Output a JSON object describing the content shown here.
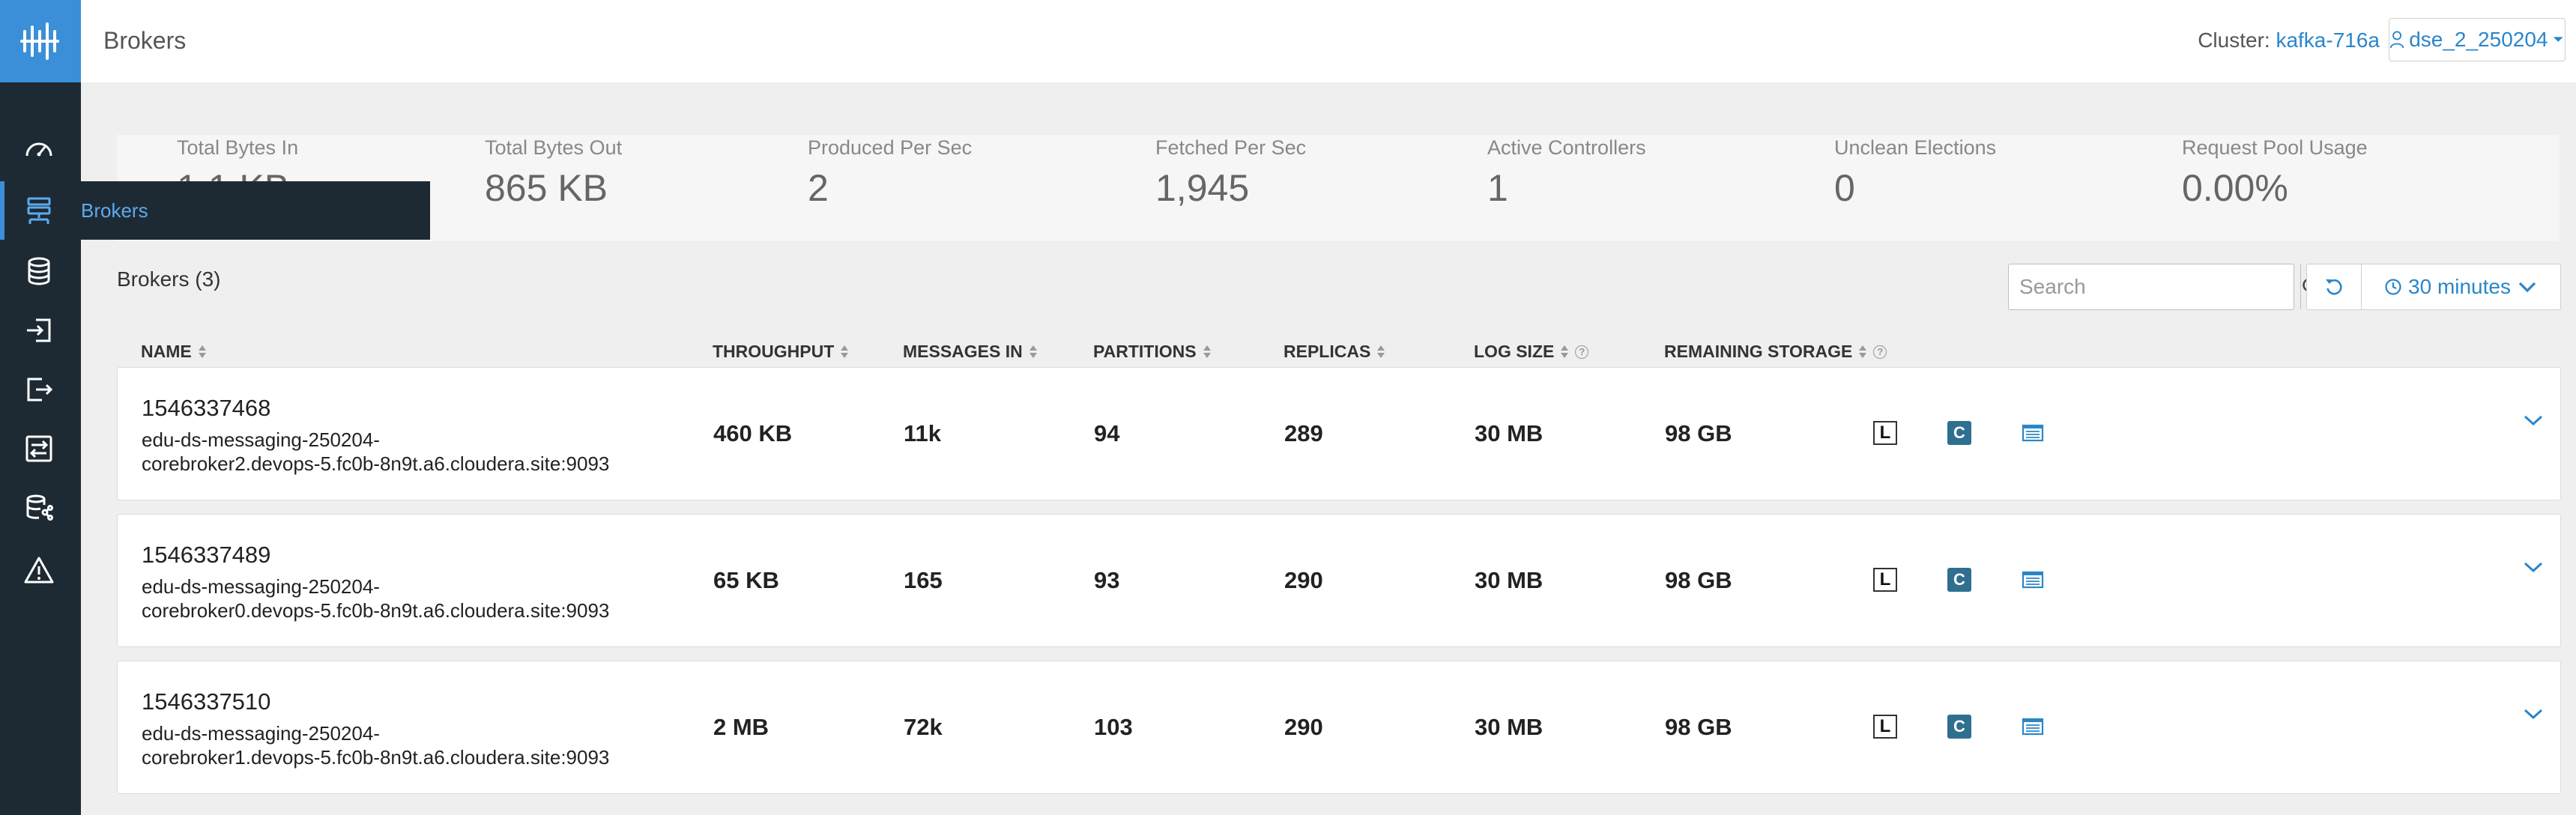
{
  "header": {
    "title": "Brokers",
    "cluster_label": "Cluster:",
    "cluster_name": "kafka-716a",
    "user": "dse_2_250204"
  },
  "sidebar": {
    "items": [
      {
        "icon": "dashboard-gauge-icon"
      },
      {
        "icon": "brokers-icon",
        "label": "Brokers",
        "active": true
      },
      {
        "icon": "database-icon"
      },
      {
        "icon": "producers-icon"
      },
      {
        "icon": "consumers-icon"
      },
      {
        "icon": "replication-icon"
      },
      {
        "icon": "data-explorer-icon"
      },
      {
        "icon": "alerts-icon"
      }
    ]
  },
  "stats": [
    {
      "label": "Total Bytes In",
      "value": "1.1 KB"
    },
    {
      "label": "Total Bytes Out",
      "value": "865 KB"
    },
    {
      "label": "Produced Per Sec",
      "value": "2"
    },
    {
      "label": "Fetched Per Sec",
      "value": "1,945"
    },
    {
      "label": "Active Controllers",
      "value": "1"
    },
    {
      "label": "Unclean Elections",
      "value": "0"
    },
    {
      "label": "Request Pool Usage",
      "value": "0.00%"
    }
  ],
  "toolbar": {
    "brokers_count": "Brokers (3)",
    "search_placeholder": "Search",
    "time_range": "30 minutes"
  },
  "table": {
    "columns": [
      "NAME",
      "THROUGHPUT",
      "MESSAGES IN",
      "PARTITIONS",
      "REPLICAS",
      "LOG SIZE",
      "REMAINING STORAGE"
    ],
    "rows": [
      {
        "id": "1546337468",
        "host_line1": "edu-ds-messaging-250204-",
        "host_line2": "corebroker2.devops-5.fc0b-8n9t.a6.cloudera.site:9093",
        "throughput": "460 KB",
        "messages_in": "11k",
        "partitions": "94",
        "replicas": "289",
        "log_size": "30 MB",
        "remaining_storage": "98 GB"
      },
      {
        "id": "1546337489",
        "host_line1": "edu-ds-messaging-250204-",
        "host_line2": "corebroker0.devops-5.fc0b-8n9t.a6.cloudera.site:9093",
        "throughput": "65 KB",
        "messages_in": "165",
        "partitions": "93",
        "replicas": "290",
        "log_size": "30 MB",
        "remaining_storage": "98 GB"
      },
      {
        "id": "1546337510",
        "host_line1": "edu-ds-messaging-250204-",
        "host_line2": "corebroker1.devops-5.fc0b-8n9t.a6.cloudera.site:9093",
        "throughput": "2 MB",
        "messages_in": "72k",
        "partitions": "103",
        "replicas": "290",
        "log_size": "30 MB",
        "remaining_storage": "98 GB"
      }
    ],
    "action_badges": {
      "log": "L",
      "config": "C"
    }
  },
  "colors": {
    "accent": "#2a86c9",
    "sidebar": "#1e2a33",
    "logo": "#3b8fd9"
  }
}
